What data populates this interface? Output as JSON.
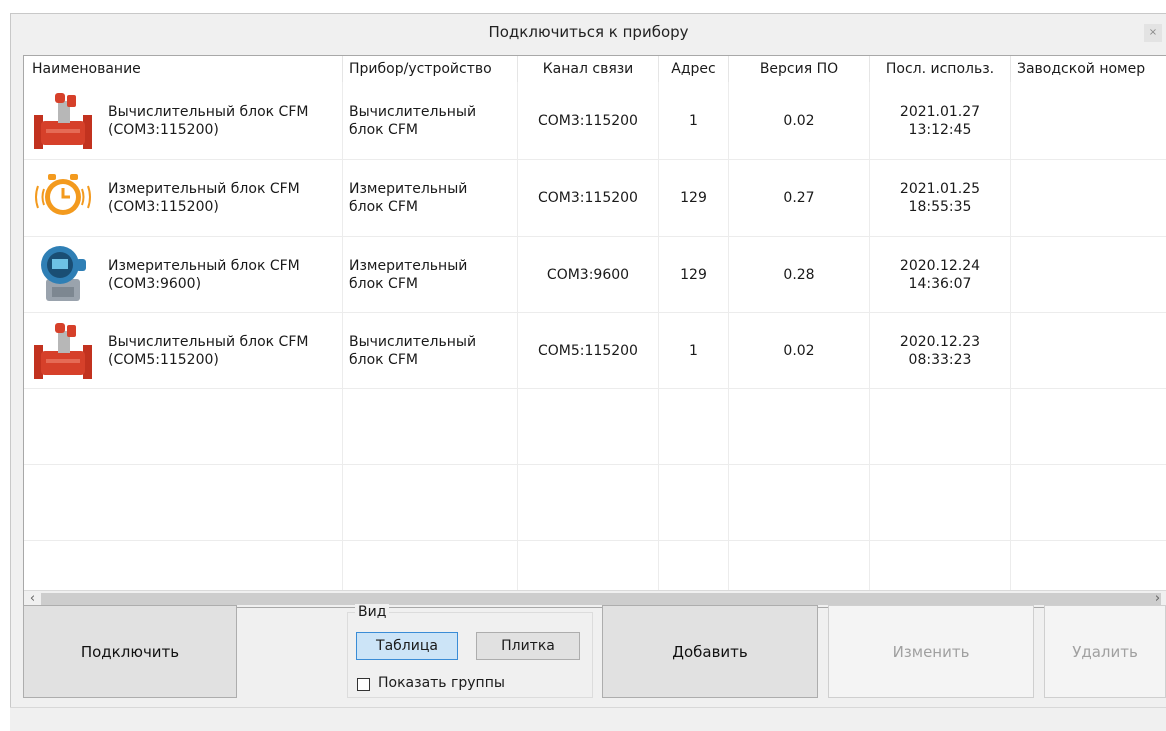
{
  "window": {
    "title": "Подключиться к прибору",
    "close_label": "×"
  },
  "table": {
    "columns": [
      "Наименование",
      "Прибор/устройство",
      "Канал связи",
      "Адрес",
      "Версия ПО",
      "Посл. использ.",
      "Заводской номер"
    ],
    "rows": [
      {
        "icon": "flowmeter-icon",
        "name1": "Вычислительный блок CFM",
        "name2": "(COM3:115200)",
        "device1": "Вычислительный",
        "device2": "блок CFM",
        "channel": "COM3:115200",
        "address": "1",
        "version": "0.02",
        "date": "2021.01.27",
        "time": "13:12:45",
        "serial": ""
      },
      {
        "icon": "alarm-clock-icon",
        "name1": "Измерительный блок CFM",
        "name2": "(COM3:115200)",
        "device1": "Измерительный",
        "device2": "блок CFM",
        "channel": "COM3:115200",
        "address": "129",
        "version": "0.27",
        "date": "2021.01.25",
        "time": "18:55:35",
        "serial": ""
      },
      {
        "icon": "transmitter-icon",
        "name1": "Измерительный блок CFM",
        "name2": "(COM3:9600)",
        "device1": "Измерительный",
        "device2": "блок CFM",
        "channel": "COM3:9600",
        "address": "129",
        "version": "0.28",
        "date": "2020.12.24",
        "time": "14:36:07",
        "serial": ""
      },
      {
        "icon": "flowmeter-icon",
        "name1": "Вычислительный блок CFM",
        "name2": "(COM5:115200)",
        "device1": "Вычислительный",
        "device2": "блок CFM",
        "channel": "COM5:115200",
        "address": "1",
        "version": "0.02",
        "date": "2020.12.23",
        "time": "08:33:23",
        "serial": ""
      }
    ]
  },
  "scroll": {
    "left_arrow": "‹",
    "right_arrow": "›"
  },
  "buttons": {
    "connect": "Подключить",
    "add": "Добавить",
    "edit": "Изменить",
    "delete": "Удалить"
  },
  "view_group": {
    "title": "Вид",
    "table_label": "Таблица",
    "tile_label": "Плитка",
    "show_groups_label": "Показать группы",
    "show_groups_checked": false,
    "selected": "Таблица"
  },
  "colors": {
    "accent": "#3a8cd6",
    "selected_fill": "#cce4f7",
    "flowmeter_body": "#d6402a",
    "clock_orange": "#f39a1e",
    "transmitter_blue": "#2f7fb5"
  }
}
